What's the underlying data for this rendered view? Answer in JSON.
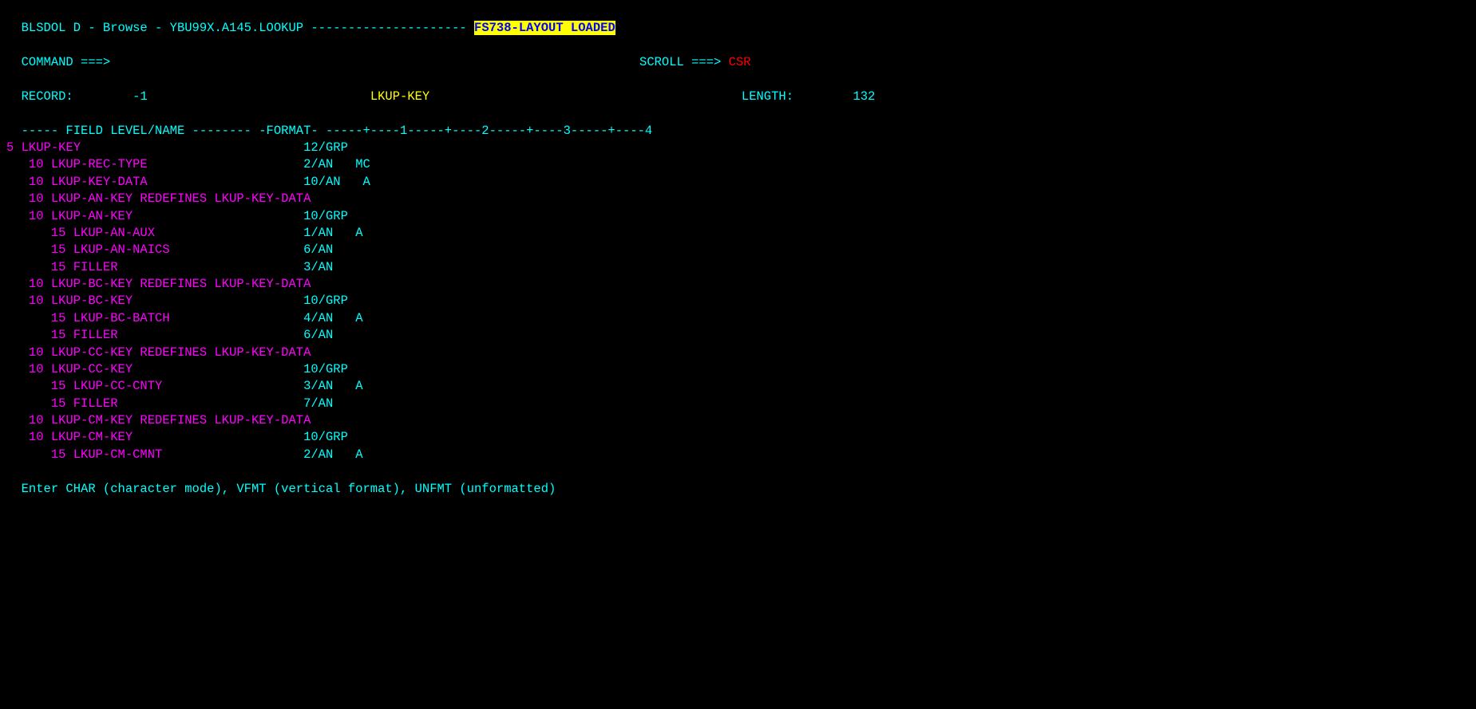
{
  "header": {
    "title_prefix": "BLSDOL D - Browse - YBU99X.A145.LOOKUP",
    "title_dashes": " --------------------- ",
    "status_label": "FS738-LAYOUT LOADED",
    "command_label": "COMMAND ===>",
    "scroll_label": "SCROLL ===>",
    "scroll_value": "CSR",
    "record_label": "RECORD:",
    "record_value": "-1",
    "lkup_key_label": "LKUP-KEY",
    "length_label": "LENGTH:",
    "length_value": "132"
  },
  "separator": "----- FIELD LEVEL/NAME -------- -FORMAT- -----+----1-----+----2-----+----3-----+----4",
  "fields": [
    {
      "indent": 0,
      "level": "5",
      "name": "LKUP-KEY",
      "format": "12/GRP",
      "attr": ""
    },
    {
      "indent": 1,
      "level": "10",
      "name": "LKUP-REC-TYPE",
      "format": "2/AN",
      "attr": "MC"
    },
    {
      "indent": 1,
      "level": "10",
      "name": "LKUP-KEY-DATA",
      "format": "10/AN",
      "attr": "A"
    },
    {
      "indent": 1,
      "level": "10",
      "name": "LKUP-AN-KEY REDEFINES LKUP-KEY-DATA",
      "format": "",
      "attr": ""
    },
    {
      "indent": 1,
      "level": "10",
      "name": "LKUP-AN-KEY",
      "format": "10/GRP",
      "attr": ""
    },
    {
      "indent": 2,
      "level": "15",
      "name": "LKUP-AN-AUX",
      "format": "1/AN",
      "attr": "A"
    },
    {
      "indent": 2,
      "level": "15",
      "name": "LKUP-AN-NAICS",
      "format": "6/AN",
      "attr": ""
    },
    {
      "indent": 2,
      "level": "15",
      "name": "FILLER",
      "format": "3/AN",
      "attr": ""
    },
    {
      "indent": 1,
      "level": "10",
      "name": "LKUP-BC-KEY REDEFINES LKUP-KEY-DATA",
      "format": "",
      "attr": ""
    },
    {
      "indent": 1,
      "level": "10",
      "name": "LKUP-BC-KEY",
      "format": "10/GRP",
      "attr": ""
    },
    {
      "indent": 2,
      "level": "15",
      "name": "LKUP-BC-BATCH",
      "format": "4/AN",
      "attr": "A"
    },
    {
      "indent": 2,
      "level": "15",
      "name": "FILLER",
      "format": "6/AN",
      "attr": ""
    },
    {
      "indent": 1,
      "level": "10",
      "name": "LKUP-CC-KEY REDEFINES LKUP-KEY-DATA",
      "format": "",
      "attr": ""
    },
    {
      "indent": 1,
      "level": "10",
      "name": "LKUP-CC-KEY",
      "format": "10/GRP",
      "attr": ""
    },
    {
      "indent": 2,
      "level": "15",
      "name": "LKUP-CC-CNTY",
      "format": "3/AN",
      "attr": "A"
    },
    {
      "indent": 2,
      "level": "15",
      "name": "FILLER",
      "format": "7/AN",
      "attr": ""
    },
    {
      "indent": 1,
      "level": "10",
      "name": "LKUP-CM-KEY REDEFINES LKUP-KEY-DATA",
      "format": "",
      "attr": ""
    },
    {
      "indent": 1,
      "level": "10",
      "name": "LKUP-CM-KEY",
      "format": "10/GRP",
      "attr": ""
    },
    {
      "indent": 2,
      "level": "15",
      "name": "LKUP-CM-CMNT",
      "format": "2/AN",
      "attr": "A"
    }
  ],
  "footer": "Enter CHAR (character mode), VFMT (vertical format), UNFMT (unformatted)"
}
